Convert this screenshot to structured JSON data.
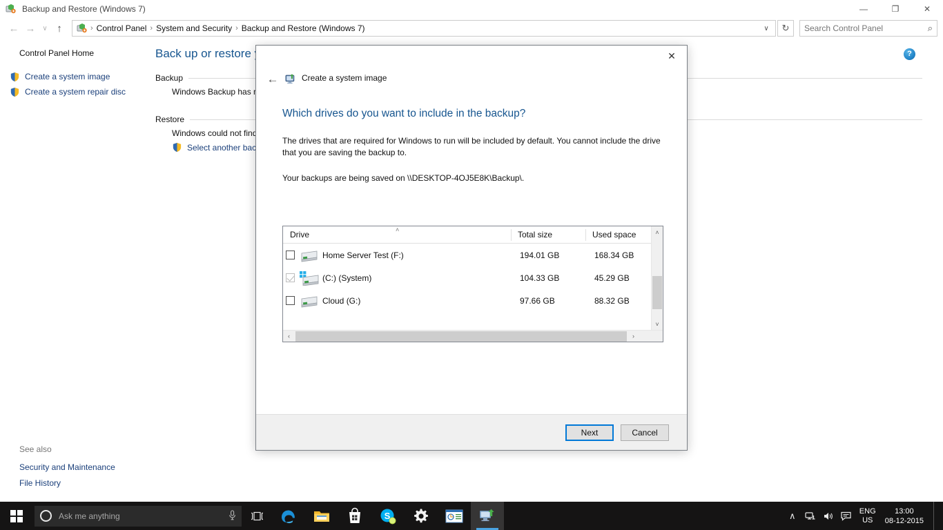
{
  "window": {
    "title": "Backup and Restore (Windows 7)",
    "title_icon": "backup-restore-icon",
    "minimize_label": "—",
    "restore_label": "❐",
    "close_label": "✕"
  },
  "nav": {
    "back_label": "←",
    "forward_label": "→",
    "recent_label": "∨",
    "up_label": "↑",
    "refresh_label": "↻",
    "dropdown_label": "∨",
    "breadcrumb": [
      "Control Panel",
      "System and Security",
      "Backup and Restore (Windows 7)"
    ],
    "separator": "›"
  },
  "search": {
    "placeholder": "Search Control Panel",
    "value": "",
    "icon": "search-icon",
    "glyph": "⌕"
  },
  "sidebar": {
    "home": "Control Panel Home",
    "items": [
      {
        "label": "Create a system image",
        "icon": "shield-icon"
      },
      {
        "label": "Create a system repair disc",
        "icon": "shield-icon"
      }
    ],
    "see_also_title": "See also",
    "see_also": [
      {
        "label": "Security and Maintenance"
      },
      {
        "label": "File History"
      }
    ]
  },
  "main": {
    "heading": "Back up or restore yo",
    "help_glyph": "?",
    "groups": [
      {
        "title": "Backup",
        "text": "Windows Backup has n"
      },
      {
        "title": "Restore",
        "text": "Windows could not find",
        "link": "Select another backu"
      }
    ]
  },
  "dialog": {
    "close_label": "✕",
    "back_label": "←",
    "app_icon": "create-system-image-icon",
    "app_title": "Create a system image",
    "heading": "Which drives do you want to include in the backup?",
    "description": "The drives that are required for Windows to run will be included by default. You cannot include the drive that you are saving the backup to.",
    "save_location_text": "Your backups are being saved on \\\\DESKTOP-4OJ5E8K\\Backup\\.",
    "table": {
      "columns": [
        "Drive",
        "Total size",
        "Used space"
      ],
      "sort_caret": "˄",
      "rows": [
        {
          "checked": false,
          "disabled": false,
          "system": false,
          "name": "Home Server Test (F:)",
          "total": "194.01 GB",
          "used": "168.34 GB"
        },
        {
          "checked": true,
          "disabled": true,
          "system": true,
          "name": "(C:) (System)",
          "total": "104.33 GB",
          "used": "45.29 GB"
        },
        {
          "checked": false,
          "disabled": false,
          "system": false,
          "name": "Cloud (G:)",
          "total": "97.66 GB",
          "used": "88.32 GB"
        }
      ],
      "scroll_up": "˄",
      "scroll_down": "˅",
      "scroll_left": "‹",
      "scroll_right": "›"
    },
    "buttons": {
      "next": "Next",
      "cancel": "Cancel"
    }
  },
  "taskbar": {
    "start_label": "start-button",
    "cortana_placeholder": "Ask me anything",
    "mic_glyph": "ƥ",
    "taskview_glyph": "❐",
    "apps": [
      {
        "name": "edge",
        "glyph": "e"
      },
      {
        "name": "file-explorer",
        "glyph": ""
      },
      {
        "name": "microsoft-store",
        "glyph": ""
      },
      {
        "name": "skype",
        "glyph": "S"
      },
      {
        "name": "settings",
        "glyph": "⚙"
      },
      {
        "name": "office-contacts",
        "glyph": ""
      },
      {
        "name": "backup-and-restore",
        "glyph": ""
      }
    ],
    "tray": {
      "chevron": "∧",
      "network": "⌗",
      "volume": "ᵖ",
      "action_center": "▢",
      "language": "ENG",
      "region": "US",
      "time": "13:00",
      "date": "08-12-2015"
    }
  },
  "colors": {
    "accent_blue": "#0078d7",
    "heading_blue": "#16558f",
    "link_blue": "#1a3f7a",
    "taskbar": "#121212"
  }
}
